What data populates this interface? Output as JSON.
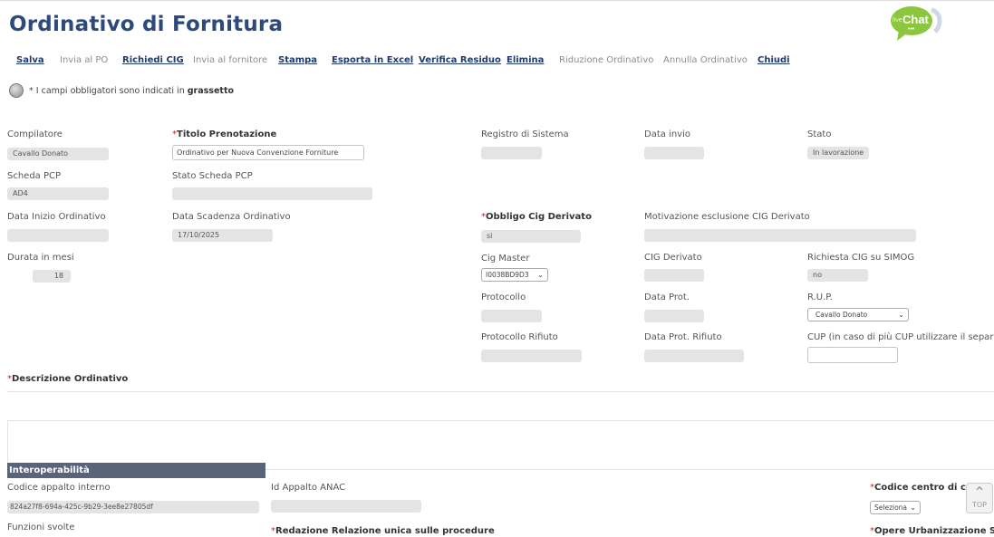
{
  "page": {
    "title": "Ordinativo di Fornitura"
  },
  "chat": {
    "label": "Chat",
    "prefix": "live"
  },
  "toolbar": {
    "items": [
      {
        "label": "Salva",
        "enabled": true
      },
      {
        "label": "Invia al PO",
        "enabled": false
      },
      {
        "label": "Richiedi CIG",
        "enabled": true
      },
      {
        "label": "Invia al fornitore",
        "enabled": false
      },
      {
        "label": "Stampa",
        "enabled": true
      },
      {
        "label": "Esporta in Excel",
        "enabled": true
      },
      {
        "label": "Verifica Residuo",
        "enabled": true
      },
      {
        "label": "Elimina",
        "enabled": true
      },
      {
        "label": "Riduzione Ordinativo",
        "enabled": false
      },
      {
        "label": "Annulla Ordinativo",
        "enabled": false
      },
      {
        "label": "Chiudi",
        "enabled": true
      }
    ]
  },
  "note": {
    "text": "* I campi obbligatori sono indicati in ",
    "bold": "grassetto"
  },
  "fields": {
    "compilatore": {
      "label": "Compilatore",
      "value": "Cavallo Donato"
    },
    "titolo": {
      "label": "Titolo Prenotazione",
      "value": "Ordinativo per Nuova Convenzione Forniture"
    },
    "registro": {
      "label": "Registro di Sistema",
      "value": ""
    },
    "data_invio": {
      "label": "Data invio",
      "value": ""
    },
    "stato": {
      "label": "Stato",
      "value": "In lavorazione"
    },
    "scheda_pcp": {
      "label": "Scheda PCP",
      "value": "AD4"
    },
    "stato_scheda_pcp": {
      "label": "Stato Scheda PCP",
      "value": ""
    },
    "data_inizio": {
      "label": "Data Inizio Ordinativo",
      "value": ""
    },
    "data_scadenza": {
      "label": "Data Scadenza Ordinativo",
      "value": "17/10/2025"
    },
    "obbligo_cig": {
      "label": "Obbligo Cig Derivato",
      "value": "si"
    },
    "motivazione": {
      "label": "Motivazione esclusione CIG Derivato",
      "value": ""
    },
    "durata": {
      "label": "Durata in mesi",
      "value": "18"
    },
    "cig_master": {
      "label": "Cig Master",
      "value": "I0038BD9D3"
    },
    "cig_derivato": {
      "label": "CIG Derivato",
      "value": ""
    },
    "richiesta_cig": {
      "label": "Richiesta CIG su SIMOG",
      "value": "no"
    },
    "protocollo": {
      "label": "Protocollo",
      "value": ""
    },
    "data_prot": {
      "label": "Data Prot.",
      "value": ""
    },
    "rup": {
      "label": "R.U.P.",
      "value": "Cavallo Donato"
    },
    "protocollo_rifiuto": {
      "label": "Protocollo Rifiuto",
      "value": ""
    },
    "data_prot_rifiuto": {
      "label": "Data Prot. Rifiuto",
      "value": ""
    },
    "cup": {
      "label": "CUP (in caso di più CUP utilizzare il separatore '",
      "value": ""
    },
    "descrizione": {
      "label": "Descrizione Ordinativo",
      "value": ""
    }
  },
  "interop": {
    "header": "Interoperabilità",
    "codice_appalto": {
      "label": "Codice appalto interno",
      "value": "824a27f8-694a-425c-9b29-3ee8e27805df"
    },
    "id_appalto": {
      "label": "Id Appalto ANAC",
      "value": ""
    },
    "centro_costo": {
      "label": "Codice centro di costo",
      "value": "Seleziona"
    },
    "funzioni": {
      "label": "Funzioni svolte"
    },
    "redazione": {
      "label": "Redazione Relazione unica sulle procedure"
    },
    "opere": {
      "label": "Opere Urbanizzazione Scomp"
    }
  },
  "top_button": {
    "label": "TOP"
  }
}
